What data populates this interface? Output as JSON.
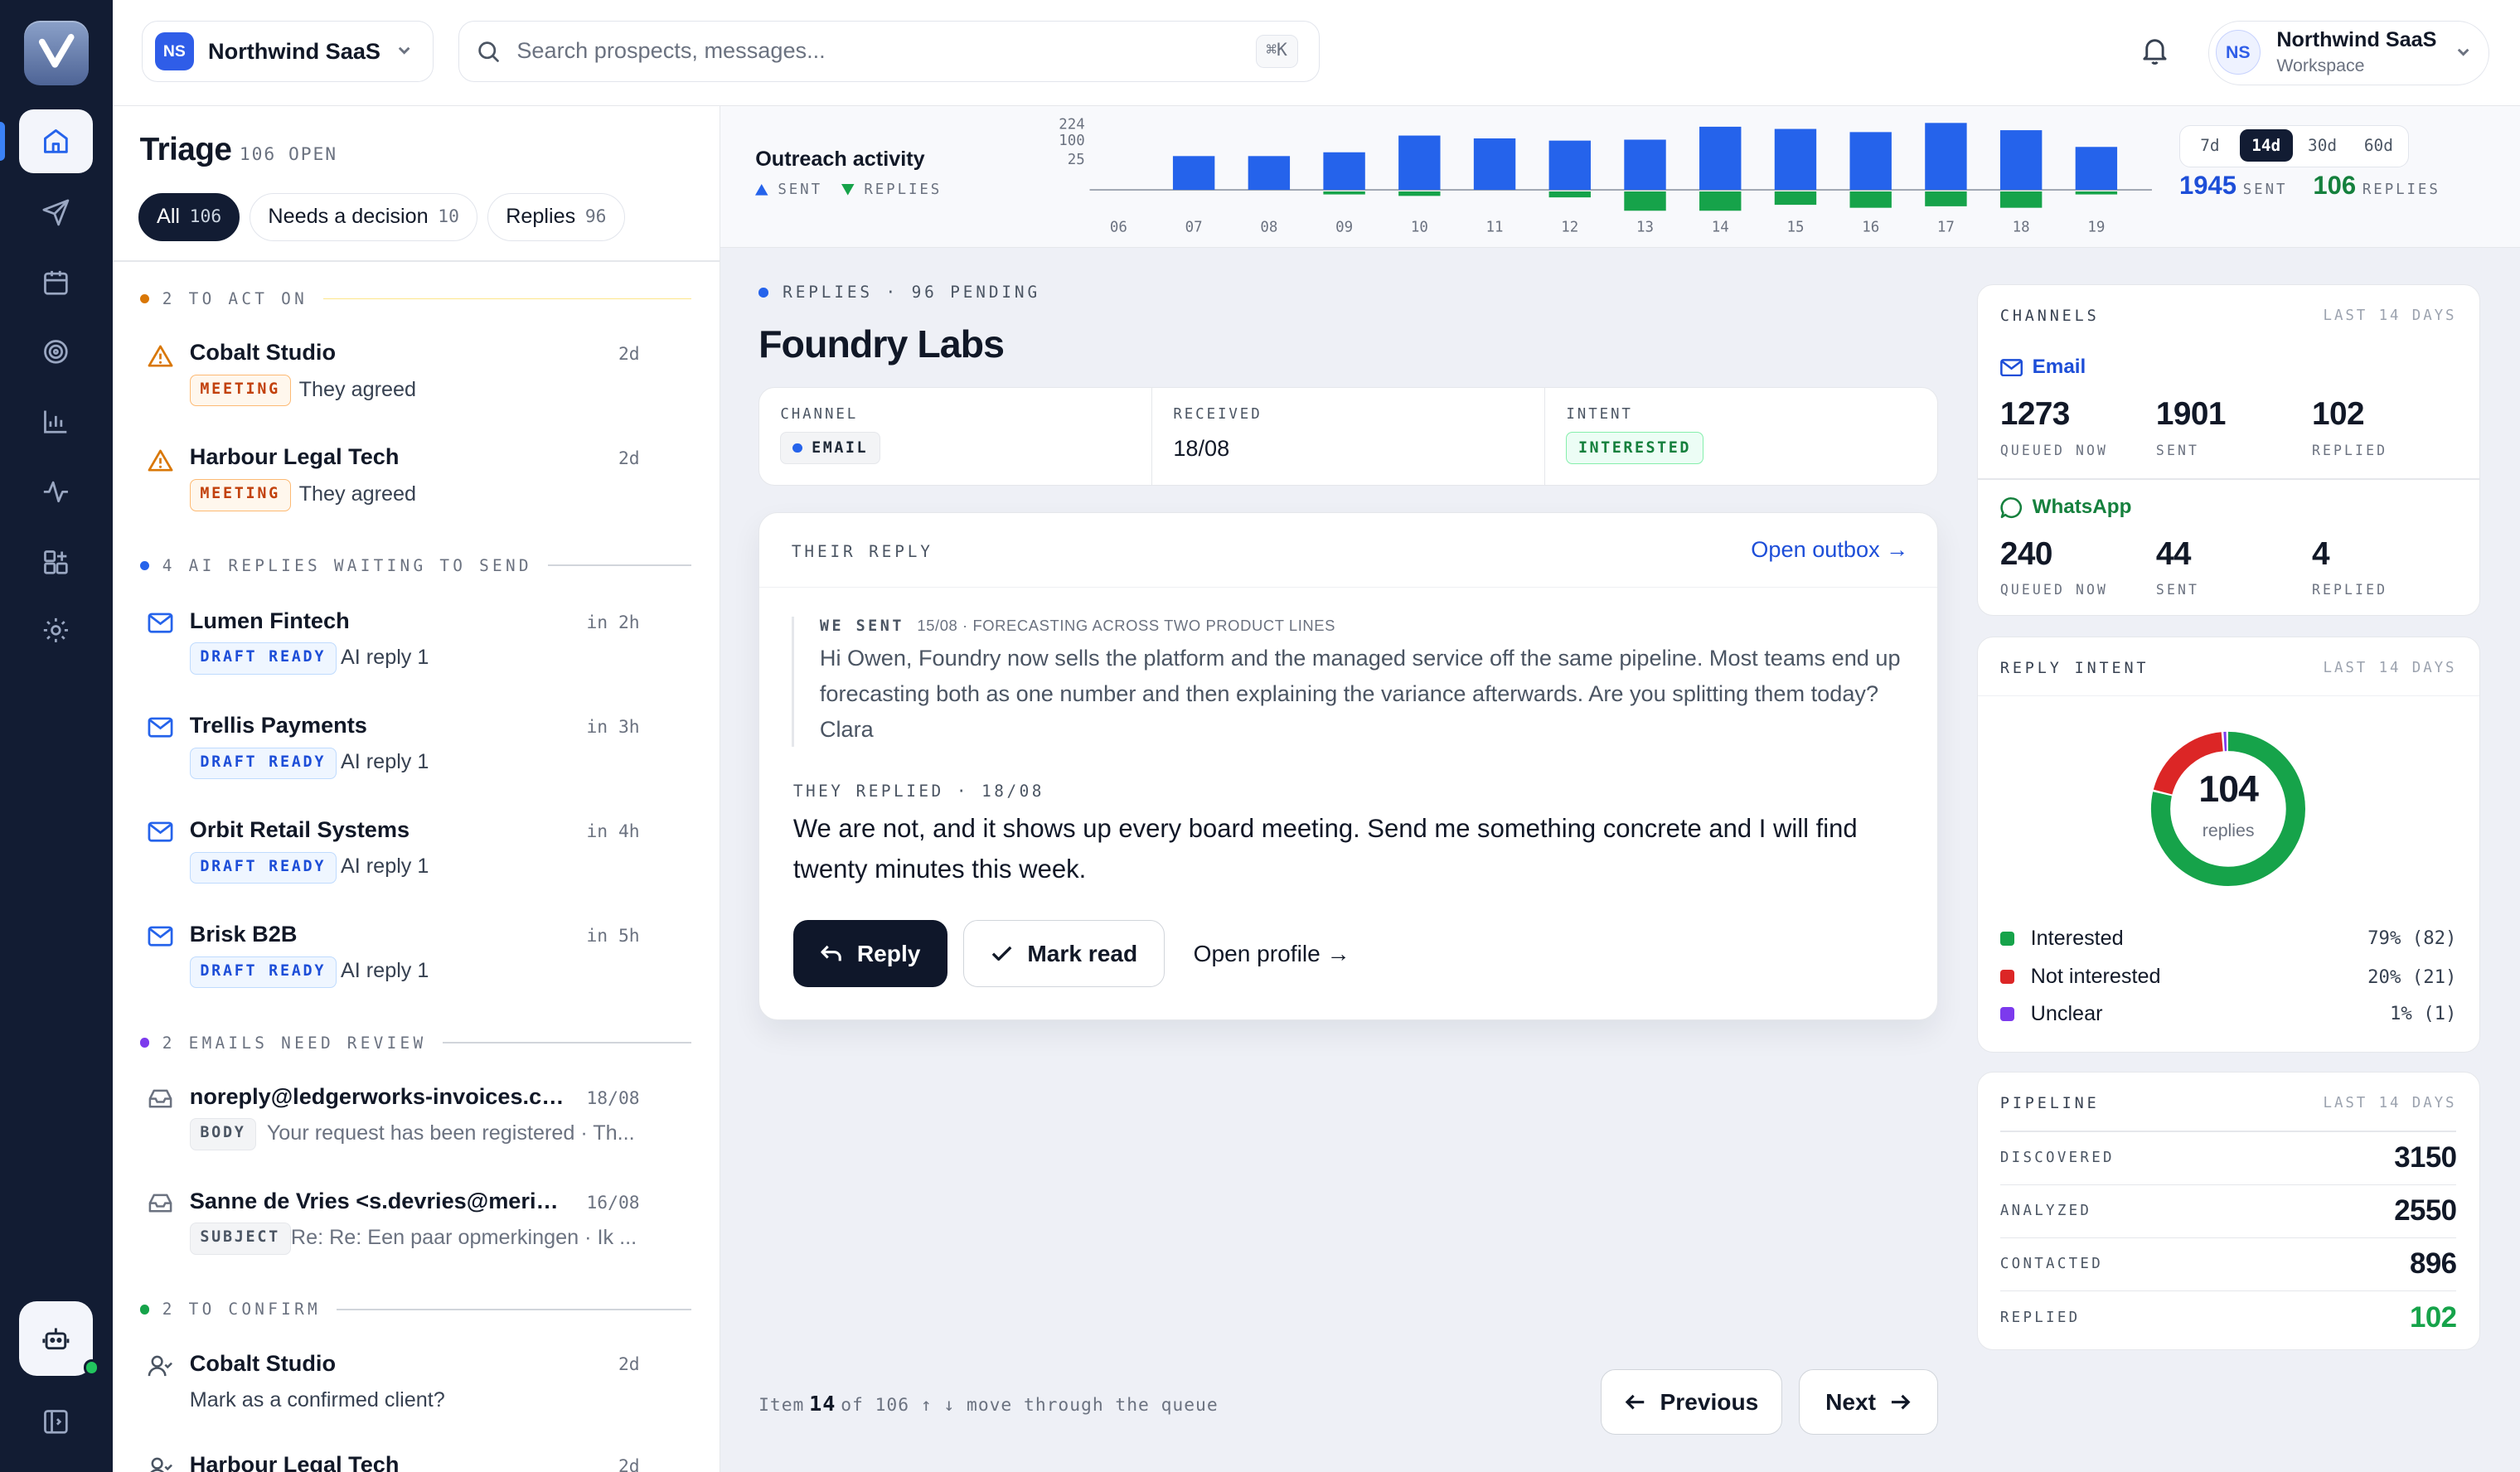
{
  "topbar": {
    "workspace_badge": "NS",
    "workspace_name": "Northwind SaaS",
    "search_placeholder": "Search prospects, messages...",
    "search_shortcut": "⌘K",
    "account_initials": "NS",
    "account_name": "Northwind SaaS",
    "account_sub": "Workspace"
  },
  "triage": {
    "title": "Triage",
    "open_count": "106 OPEN",
    "filters": [
      {
        "label": "All",
        "count": "106"
      },
      {
        "label": "Needs a decision",
        "count": "10"
      },
      {
        "label": "Replies",
        "count": "96"
      }
    ],
    "sections": [
      {
        "label": "2 TO ACT ON",
        "color": "#d97706"
      },
      {
        "label": "4 AI REPLIES WAITING TO SEND",
        "color": "#2563eb"
      },
      {
        "label": "2 EMAILS NEED REVIEW",
        "color": "#7c3aed"
      },
      {
        "label": "2 TO CONFIRM",
        "color": "#16a34a"
      }
    ],
    "items": [
      {
        "name": "Cobalt Studio",
        "time": "2d",
        "tag": "MEETING",
        "sub": "They agreed"
      },
      {
        "name": "Harbour Legal Tech",
        "time": "2d",
        "tag": "MEETING",
        "sub": "They agreed"
      },
      {
        "name": "Lumen Fintech",
        "time": "in 2h",
        "tag": "DRAFT READY",
        "sub": "AI reply 1"
      },
      {
        "name": "Trellis Payments",
        "time": "in 3h",
        "tag": "DRAFT READY",
        "sub": "AI reply 1"
      },
      {
        "name": "Orbit Retail Systems",
        "time": "in 4h",
        "tag": "DRAFT READY",
        "sub": "AI reply 1"
      },
      {
        "name": "Brisk B2B",
        "time": "in 5h",
        "tag": "DRAFT READY",
        "sub": "AI reply 1"
      },
      {
        "name": "noreply@ledgerworks-invoices.com",
        "time": "18/08",
        "tag": "BODY",
        "sub": "Your request has been registered · Th..."
      },
      {
        "name": "Sanne de Vries <s.devries@meridia...",
        "time": "16/08",
        "tag": "SUBJECT",
        "sub": "Re: Re: Een paar opmerkingen · Ik ..."
      },
      {
        "name": "Cobalt Studio",
        "time": "2d",
        "tag": "",
        "sub": "Mark as a confirmed client?"
      },
      {
        "name": "Harbour Legal Tech",
        "time": "2d",
        "tag": "",
        "sub": ""
      }
    ]
  },
  "outreach": {
    "title": "Outreach activity",
    "legend_sent": "SENT",
    "legend_replies": "REPLIES",
    "ranges": [
      "7d",
      "14d",
      "30d",
      "60d"
    ],
    "active_range": "14d",
    "sent_total": "1945",
    "sent_label": "SENT",
    "replies_total": "106",
    "replies_label": "REPLIES"
  },
  "chart_data": {
    "type": "bar",
    "title": "Outreach activity",
    "categories": [
      "06",
      "07",
      "08",
      "09",
      "10",
      "11",
      "12",
      "13",
      "14",
      "15",
      "16",
      "17",
      "18",
      "19"
    ],
    "y_ticks": [
      "224",
      "100",
      "25"
    ],
    "series": [
      {
        "name": "SENT",
        "color": "#2563eb",
        "values": [
          0,
          107,
          107,
          119,
          172,
          163,
          156,
          159,
          200,
          193,
          183,
          212,
          189,
          136
        ]
      },
      {
        "name": "REPLIES",
        "color": "#16a34a",
        "values": [
          0,
          0,
          0,
          2,
          3,
          0,
          4,
          13,
          13,
          9,
          11,
          10,
          11,
          2
        ]
      }
    ],
    "grid": false
  },
  "reply": {
    "status": "REPLIES · 96 PENDING",
    "company": "Foundry Labs",
    "channel_label": "CHANNEL",
    "channel_value": "EMAIL",
    "received_label": "RECEIVED",
    "received_value": "18/08",
    "intent_label": "INTENT",
    "intent_value": "INTERESTED",
    "card_title": "THEIR REPLY",
    "open_outbox": "Open outbox →",
    "we_sent_label": "WE SENT",
    "we_sent_meta": "15/08 · FORECASTING ACROSS TWO PRODUCT LINES",
    "we_sent_body": "Hi Owen, Foundry now sells the platform and the managed service off the same pipeline. Most teams end up forecasting both as one number and then explaining the variance afterwards. Are you splitting them today? Clara",
    "they_replied_label": "THEY REPLIED · 18/08",
    "they_replied_body": "We are not, and it shows up every board meeting. Send me something concrete and I will find twenty minutes this week.",
    "reply_button": "Reply",
    "mark_read_button": "Mark read",
    "open_profile": "Open profile →"
  },
  "queue": {
    "prefix": "Item",
    "current": "14",
    "suffix": "of 106  ↑ ↓ move through the queue",
    "previous": "Previous",
    "next": "Next"
  },
  "channels": {
    "title": "CHANNELS",
    "range": "LAST 14 DAYS",
    "list": [
      {
        "name": "Email",
        "color": "#1d4ed8",
        "stats": [
          {
            "n": "1273",
            "l": "QUEUED NOW"
          },
          {
            "n": "1901",
            "l": "SENT"
          },
          {
            "n": "102",
            "l": "REPLIED"
          }
        ]
      },
      {
        "name": "WhatsApp",
        "color": "#15803d",
        "stats": [
          {
            "n": "240",
            "l": "QUEUED NOW"
          },
          {
            "n": "44",
            "l": "SENT"
          },
          {
            "n": "4",
            "l": "REPLIED"
          }
        ]
      }
    ]
  },
  "intent": {
    "title": "REPLY INTENT",
    "range": "LAST 14 DAYS",
    "total": "104",
    "total_label": "replies",
    "slices": [
      {
        "label": "Interested",
        "value": "79% (82)",
        "pct": 79,
        "color": "#16a34a"
      },
      {
        "label": "Not interested",
        "value": "20% (21)",
        "pct": 20,
        "color": "#dc2626"
      },
      {
        "label": "Unclear",
        "value": "1% (1)",
        "pct": 1,
        "color": "#7c3aed"
      }
    ]
  },
  "pipeline": {
    "title": "PIPELINE",
    "range": "LAST 14 DAYS",
    "rows": [
      {
        "label": "DISCOVERED",
        "value": "3150",
        "color": "#111827"
      },
      {
        "label": "ANALYZED",
        "value": "2550",
        "color": "#111827"
      },
      {
        "label": "CONTACTED",
        "value": "896",
        "color": "#111827"
      },
      {
        "label": "REPLIED",
        "value": "102",
        "color": "#16a34a"
      }
    ]
  }
}
